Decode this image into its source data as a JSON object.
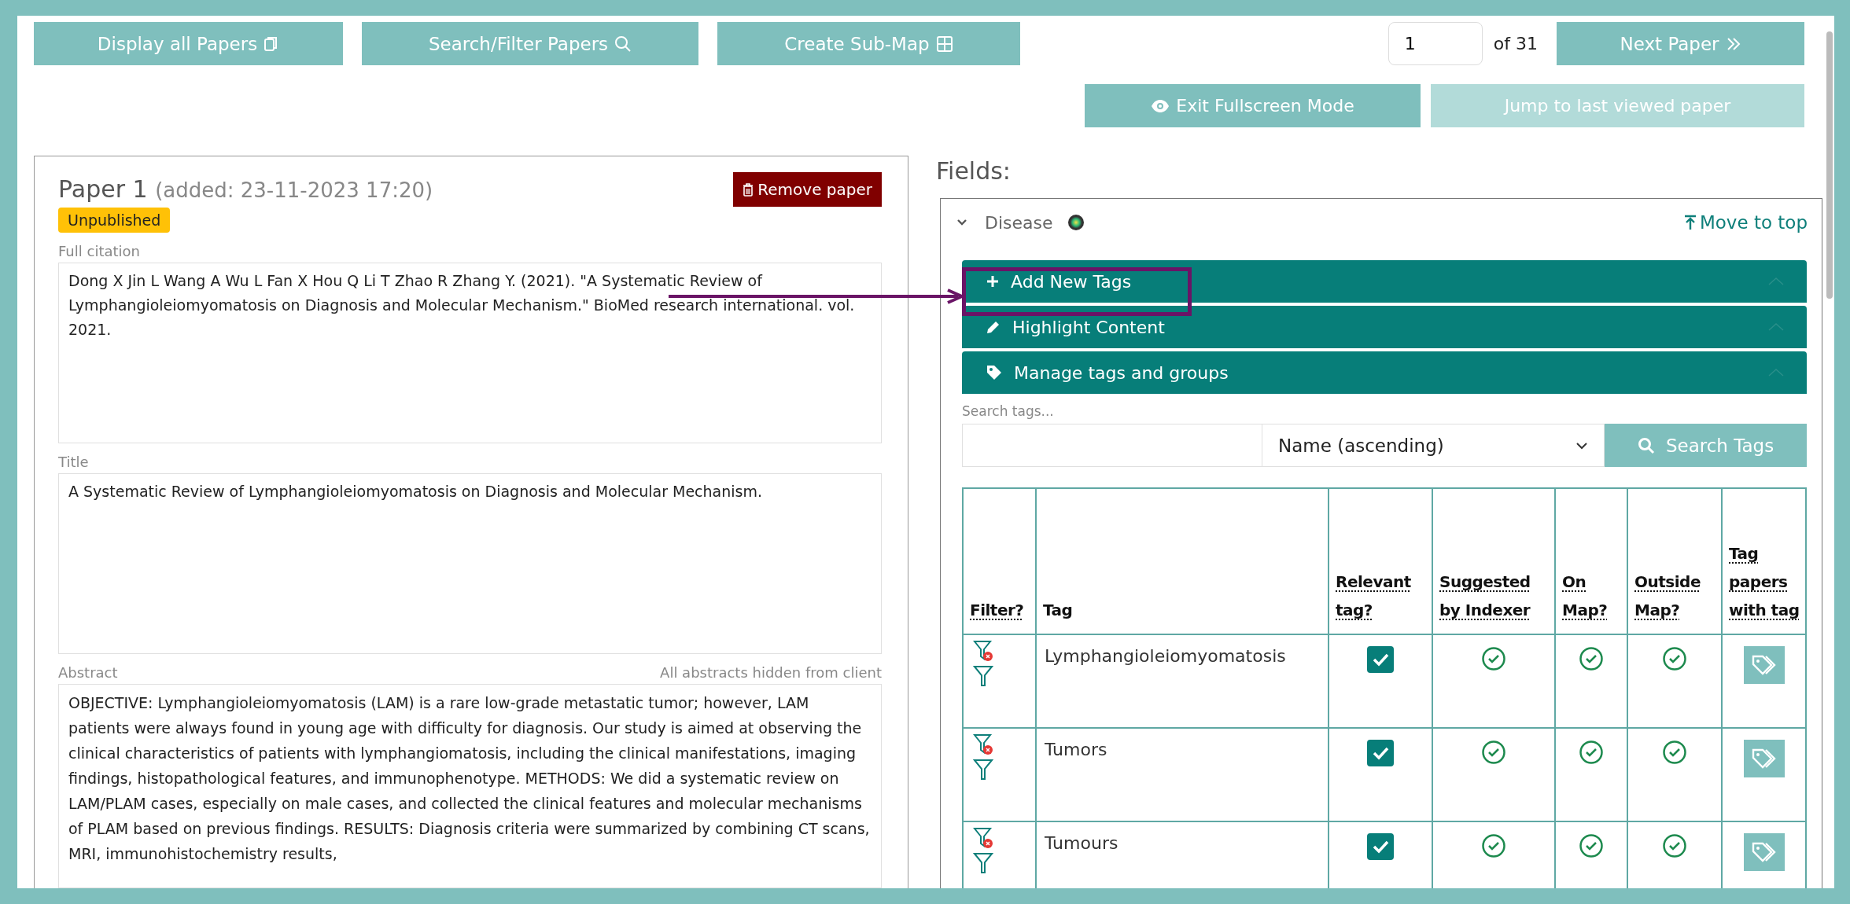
{
  "toolbar": {
    "buttons": [
      {
        "label": "Display all Papers"
      },
      {
        "label": "Search/Filter Papers"
      },
      {
        "label": "Create Sub-Map"
      }
    ],
    "page_number": "1",
    "page_total": "of 31",
    "next_button": "Next Paper",
    "secondary_buttons": [
      {
        "label": "Exit Fullscreen Mode",
        "disabled": false
      },
      {
        "label": "Jump to last viewed paper",
        "disabled": true
      }
    ]
  },
  "paper": {
    "heading": "Paper 1",
    "added": "(added: 23-11-2023 17:20)",
    "remove_button": "Remove paper",
    "status_badge": "Unpublished",
    "fields": [
      {
        "label": "Full citation",
        "value": "Dong X Jin L Wang A Wu L Fan X Hou Q Li T Zhao R Zhang Y. (2021). \"A Systematic Review of Lymphangioleiomyomatosis on Diagnosis and Molecular Mechanism.\" BioMed research international. vol. 2021."
      },
      {
        "label": "Title",
        "value": "A Systematic Review of Lymphangioleiomyomatosis on Diagnosis and Molecular Mechanism."
      },
      {
        "label": "Abstract",
        "note": "All abstracts hidden from client",
        "value": "OBJECTIVE: Lymphangioleiomyomatosis (LAM) is a rare low-grade metastatic tumor; however, LAM patients were always found in young age with difficulty for diagnosis. Our study is aimed at observing the clinical characteristics of patients with lymphangiomatosis, including the clinical manifestations, imaging findings, histopathological features, and immunophenotype. METHODS: We did a systematic review on LAM/PLAM cases, especially on male cases, and collected the clinical features and molecular mechanisms of PLAM based on previous findings. RESULTS: Diagnosis criteria were summarized by combining CT scans, MRI, immunohistochemistry results,"
      }
    ]
  },
  "fields_panel": {
    "heading": "Fields:",
    "field": {
      "name": "Disease",
      "expanded": true,
      "move_to_top": "Move to top"
    },
    "accordions": [
      {
        "label": "Add New Tags",
        "annotated": true
      },
      {
        "label": "Highlight Content",
        "annotated": false
      },
      {
        "label": "Manage tags and groups",
        "annotated": false
      }
    ],
    "search": {
      "label": "Search tags...",
      "sort": "Name (ascending)",
      "button": "Search Tags"
    },
    "table": {
      "columns": [
        "Filter?",
        "Tag",
        "Relevant tag?",
        "Suggested by Indexer",
        "On Map?",
        "Outside Map?",
        "Tag papers with tag"
      ],
      "rows": [
        {
          "tag": "Lymphangioleiomyomatosis",
          "relevant": true,
          "suggested": true,
          "on_map": true,
          "outside_map": true
        },
        {
          "tag": "Tumors",
          "relevant": true,
          "suggested": true,
          "on_map": true,
          "outside_map": true
        },
        {
          "tag": "Tumours",
          "relevant": true,
          "suggested": true,
          "on_map": true,
          "outside_map": true
        }
      ]
    }
  }
}
